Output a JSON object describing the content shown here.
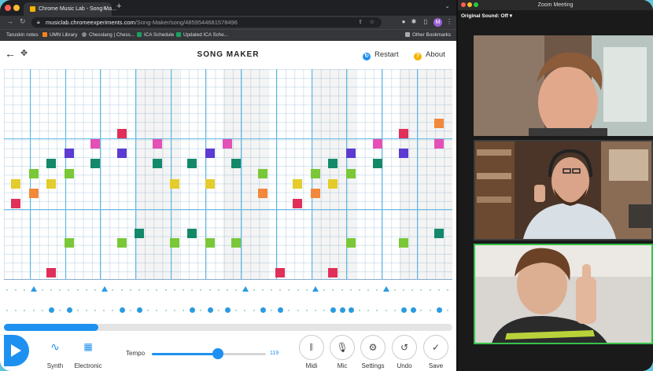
{
  "browser": {
    "tab_title": "Chrome Music Lab - Song Ma…",
    "url_host": "musiclab.chromeexperiments.com",
    "url_path": "/Song-Maker/song/4859544681578496",
    "profile_initial": "M",
    "bookmarks": [
      "Taruskin notes",
      "UMN Library",
      "Chesslang | Chess...",
      "ICA Schedule",
      "Updated ICA Sche..."
    ],
    "other_bookmarks": "Other Bookmarks"
  },
  "songmaker": {
    "title": "SONG MAKER",
    "restart_label": "Restart",
    "about_label": "About",
    "playhead_progress": 0.21,
    "instruments": {
      "melody_label": "Synth",
      "percussion_label": "Electronic"
    },
    "tempo": {
      "label": "Tempo",
      "value": "119",
      "position": 0.58
    },
    "buttons": {
      "midi": "Midi",
      "mic": "Mic",
      "settings": "Settings",
      "undo": "Undo",
      "save": "Save"
    },
    "colors": {
      "red": "#e02f59",
      "orange": "#f2883a",
      "yellow": "#e3cc2c",
      "lightgreen": "#7ac738",
      "darkgreen": "#13896a",
      "purple": "#5b3bd1",
      "pink": "#e550b6",
      "blue": "#1e90f0"
    }
  },
  "zoom": {
    "window_title": "Zoom Meeting",
    "original_sound": "Original Sound: Off"
  }
}
